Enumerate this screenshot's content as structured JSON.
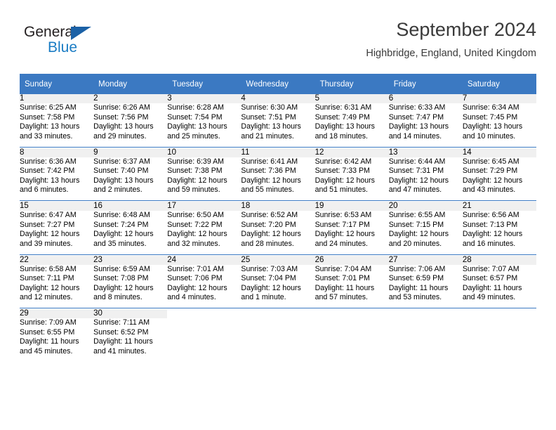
{
  "brand": {
    "name_part1": "General",
    "name_part2": "Blue"
  },
  "header": {
    "title": "September 2024",
    "subtitle": "Highbridge, England, United Kingdom"
  },
  "colors": {
    "header_blue": "#3b79c2",
    "brand_blue": "#1a7cc4",
    "logo_triangle": "#1b61a6",
    "daynum_bg": "#f0f0f0",
    "text": "#000000"
  },
  "weekdays": [
    "Sunday",
    "Monday",
    "Tuesday",
    "Wednesday",
    "Thursday",
    "Friday",
    "Saturday"
  ],
  "weeks": [
    [
      {
        "day": "1",
        "sunrise": "Sunrise: 6:25 AM",
        "sunset": "Sunset: 7:58 PM",
        "daylight1": "Daylight: 13 hours",
        "daylight2": "and 33 minutes."
      },
      {
        "day": "2",
        "sunrise": "Sunrise: 6:26 AM",
        "sunset": "Sunset: 7:56 PM",
        "daylight1": "Daylight: 13 hours",
        "daylight2": "and 29 minutes."
      },
      {
        "day": "3",
        "sunrise": "Sunrise: 6:28 AM",
        "sunset": "Sunset: 7:54 PM",
        "daylight1": "Daylight: 13 hours",
        "daylight2": "and 25 minutes."
      },
      {
        "day": "4",
        "sunrise": "Sunrise: 6:30 AM",
        "sunset": "Sunset: 7:51 PM",
        "daylight1": "Daylight: 13 hours",
        "daylight2": "and 21 minutes."
      },
      {
        "day": "5",
        "sunrise": "Sunrise: 6:31 AM",
        "sunset": "Sunset: 7:49 PM",
        "daylight1": "Daylight: 13 hours",
        "daylight2": "and 18 minutes."
      },
      {
        "day": "6",
        "sunrise": "Sunrise: 6:33 AM",
        "sunset": "Sunset: 7:47 PM",
        "daylight1": "Daylight: 13 hours",
        "daylight2": "and 14 minutes."
      },
      {
        "day": "7",
        "sunrise": "Sunrise: 6:34 AM",
        "sunset": "Sunset: 7:45 PM",
        "daylight1": "Daylight: 13 hours",
        "daylight2": "and 10 minutes."
      }
    ],
    [
      {
        "day": "8",
        "sunrise": "Sunrise: 6:36 AM",
        "sunset": "Sunset: 7:42 PM",
        "daylight1": "Daylight: 13 hours",
        "daylight2": "and 6 minutes."
      },
      {
        "day": "9",
        "sunrise": "Sunrise: 6:37 AM",
        "sunset": "Sunset: 7:40 PM",
        "daylight1": "Daylight: 13 hours",
        "daylight2": "and 2 minutes."
      },
      {
        "day": "10",
        "sunrise": "Sunrise: 6:39 AM",
        "sunset": "Sunset: 7:38 PM",
        "daylight1": "Daylight: 12 hours",
        "daylight2": "and 59 minutes."
      },
      {
        "day": "11",
        "sunrise": "Sunrise: 6:41 AM",
        "sunset": "Sunset: 7:36 PM",
        "daylight1": "Daylight: 12 hours",
        "daylight2": "and 55 minutes."
      },
      {
        "day": "12",
        "sunrise": "Sunrise: 6:42 AM",
        "sunset": "Sunset: 7:33 PM",
        "daylight1": "Daylight: 12 hours",
        "daylight2": "and 51 minutes."
      },
      {
        "day": "13",
        "sunrise": "Sunrise: 6:44 AM",
        "sunset": "Sunset: 7:31 PM",
        "daylight1": "Daylight: 12 hours",
        "daylight2": "and 47 minutes."
      },
      {
        "day": "14",
        "sunrise": "Sunrise: 6:45 AM",
        "sunset": "Sunset: 7:29 PM",
        "daylight1": "Daylight: 12 hours",
        "daylight2": "and 43 minutes."
      }
    ],
    [
      {
        "day": "15",
        "sunrise": "Sunrise: 6:47 AM",
        "sunset": "Sunset: 7:27 PM",
        "daylight1": "Daylight: 12 hours",
        "daylight2": "and 39 minutes."
      },
      {
        "day": "16",
        "sunrise": "Sunrise: 6:48 AM",
        "sunset": "Sunset: 7:24 PM",
        "daylight1": "Daylight: 12 hours",
        "daylight2": "and 35 minutes."
      },
      {
        "day": "17",
        "sunrise": "Sunrise: 6:50 AM",
        "sunset": "Sunset: 7:22 PM",
        "daylight1": "Daylight: 12 hours",
        "daylight2": "and 32 minutes."
      },
      {
        "day": "18",
        "sunrise": "Sunrise: 6:52 AM",
        "sunset": "Sunset: 7:20 PM",
        "daylight1": "Daylight: 12 hours",
        "daylight2": "and 28 minutes."
      },
      {
        "day": "19",
        "sunrise": "Sunrise: 6:53 AM",
        "sunset": "Sunset: 7:17 PM",
        "daylight1": "Daylight: 12 hours",
        "daylight2": "and 24 minutes."
      },
      {
        "day": "20",
        "sunrise": "Sunrise: 6:55 AM",
        "sunset": "Sunset: 7:15 PM",
        "daylight1": "Daylight: 12 hours",
        "daylight2": "and 20 minutes."
      },
      {
        "day": "21",
        "sunrise": "Sunrise: 6:56 AM",
        "sunset": "Sunset: 7:13 PM",
        "daylight1": "Daylight: 12 hours",
        "daylight2": "and 16 minutes."
      }
    ],
    [
      {
        "day": "22",
        "sunrise": "Sunrise: 6:58 AM",
        "sunset": "Sunset: 7:11 PM",
        "daylight1": "Daylight: 12 hours",
        "daylight2": "and 12 minutes."
      },
      {
        "day": "23",
        "sunrise": "Sunrise: 6:59 AM",
        "sunset": "Sunset: 7:08 PM",
        "daylight1": "Daylight: 12 hours",
        "daylight2": "and 8 minutes."
      },
      {
        "day": "24",
        "sunrise": "Sunrise: 7:01 AM",
        "sunset": "Sunset: 7:06 PM",
        "daylight1": "Daylight: 12 hours",
        "daylight2": "and 4 minutes."
      },
      {
        "day": "25",
        "sunrise": "Sunrise: 7:03 AM",
        "sunset": "Sunset: 7:04 PM",
        "daylight1": "Daylight: 12 hours",
        "daylight2": "and 1 minute."
      },
      {
        "day": "26",
        "sunrise": "Sunrise: 7:04 AM",
        "sunset": "Sunset: 7:01 PM",
        "daylight1": "Daylight: 11 hours",
        "daylight2": "and 57 minutes."
      },
      {
        "day": "27",
        "sunrise": "Sunrise: 7:06 AM",
        "sunset": "Sunset: 6:59 PM",
        "daylight1": "Daylight: 11 hours",
        "daylight2": "and 53 minutes."
      },
      {
        "day": "28",
        "sunrise": "Sunrise: 7:07 AM",
        "sunset": "Sunset: 6:57 PM",
        "daylight1": "Daylight: 11 hours",
        "daylight2": "and 49 minutes."
      }
    ],
    [
      {
        "day": "29",
        "sunrise": "Sunrise: 7:09 AM",
        "sunset": "Sunset: 6:55 PM",
        "daylight1": "Daylight: 11 hours",
        "daylight2": "and 45 minutes."
      },
      {
        "day": "30",
        "sunrise": "Sunrise: 7:11 AM",
        "sunset": "Sunset: 6:52 PM",
        "daylight1": "Daylight: 11 hours",
        "daylight2": "and 41 minutes."
      },
      {
        "day": "",
        "sunrise": "",
        "sunset": "",
        "daylight1": "",
        "daylight2": ""
      },
      {
        "day": "",
        "sunrise": "",
        "sunset": "",
        "daylight1": "",
        "daylight2": ""
      },
      {
        "day": "",
        "sunrise": "",
        "sunset": "",
        "daylight1": "",
        "daylight2": ""
      },
      {
        "day": "",
        "sunrise": "",
        "sunset": "",
        "daylight1": "",
        "daylight2": ""
      },
      {
        "day": "",
        "sunrise": "",
        "sunset": "",
        "daylight1": "",
        "daylight2": ""
      }
    ]
  ]
}
